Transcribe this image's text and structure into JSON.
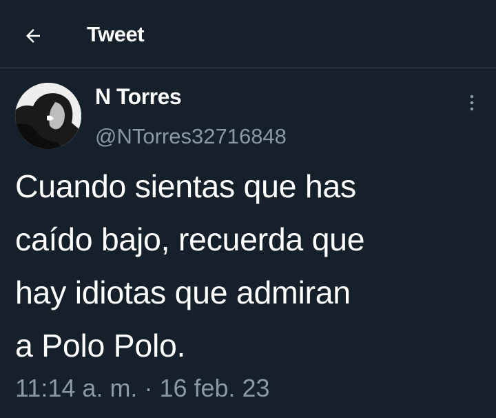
{
  "header": {
    "title": "Tweet",
    "back_icon": "arrow-left-icon"
  },
  "tweet": {
    "author": {
      "display_name": "N Torres",
      "handle": "@NTorres32716848",
      "avatar": "profile-photo"
    },
    "more_icon": "more-vertical-icon",
    "text": "Cuando sientas que has\ncaído bajo, recuerda que\nhay idiotas que admiran\na Polo Polo.",
    "time": "11:14 a. m.",
    "separator": " · ",
    "date": "16 feb. 23"
  },
  "colors": {
    "background": "#15202b",
    "text": "#ffffff",
    "secondary_text": "#8b98a5",
    "divider": "#38444d"
  }
}
